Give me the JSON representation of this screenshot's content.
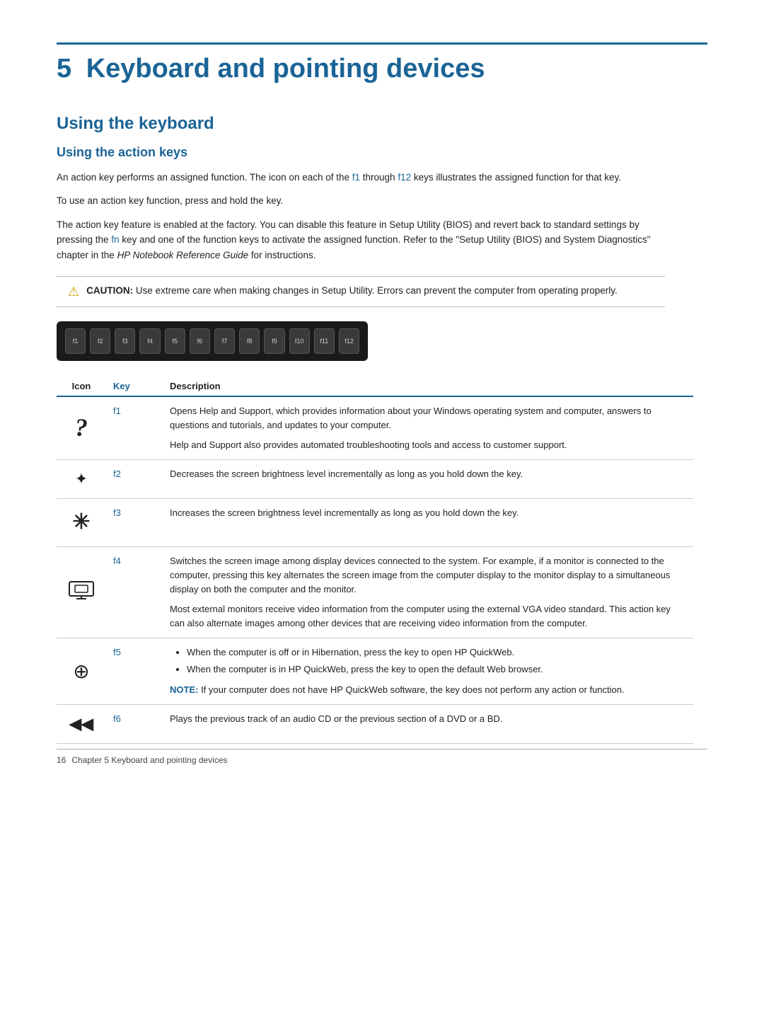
{
  "page": {
    "chapter_number": "5",
    "chapter_title": "Keyboard and pointing devices",
    "section_heading": "Using the keyboard",
    "subsection_heading": "Using the action keys",
    "paragraphs": [
      "An action key performs an assigned function. The icon on each of the f1 through f12 keys illustrates the assigned function for that key.",
      "To use an action key function, press and hold the key.",
      "The action key feature is enabled at the factory. You can disable this feature in Setup Utility (BIOS) and revert back to standard settings by pressing the fn key and one of the function keys to activate the assigned function. Refer to the “Setup Utility (BIOS) and System Diagnostics” chapter in the HP Notebook Reference Guide for instructions."
    ],
    "caution": {
      "label": "CAUTION:",
      "text": "Use extreme care when making changes in Setup Utility. Errors can prevent the computer from operating properly."
    },
    "keyboard_keys": [
      "f1",
      "f2",
      "f3",
      "f4",
      "f5",
      "f6",
      "f7",
      "f8",
      "f9",
      "f10",
      "f11",
      "f12"
    ],
    "table": {
      "headers": [
        "Icon",
        "Key",
        "Description"
      ],
      "rows": [
        {
          "icon": "?",
          "icon_type": "question",
          "key": "f1",
          "descriptions": [
            "Opens Help and Support, which provides information about your Windows operating system and computer, answers to questions and tutorials, and updates to your computer.",
            "Help and Support also provides automated troubleshooting tools and access to customer support."
          ],
          "bullets": [],
          "note": ""
        },
        {
          "icon": "☀",
          "icon_type": "sun-dim",
          "key": "f2",
          "descriptions": [
            "Decreases the screen brightness level incrementally as long as you hold down the key."
          ],
          "bullets": [],
          "note": ""
        },
        {
          "icon": "✳",
          "icon_type": "sun-bright",
          "key": "f3",
          "descriptions": [
            "Increases the screen brightness level incrementally as long as you hold down the key."
          ],
          "bullets": [],
          "note": ""
        },
        {
          "icon": "▣",
          "icon_type": "display",
          "key": "f4",
          "descriptions": [
            "Switches the screen image among display devices connected to the system. For example, if a monitor is connected to the computer, pressing this key alternates the screen image from the computer display to the monitor display to a simultaneous display on both the computer and the monitor.",
            "Most external monitors receive video information from the computer using the external VGA video standard. This action key can also alternate images among other devices that are receiving video information from the computer."
          ],
          "bullets": [],
          "note": ""
        },
        {
          "icon": "⊕",
          "icon_type": "globe",
          "key": "f5",
          "descriptions": [],
          "bullets": [
            "When the computer is off or in Hibernation, press the key to open HP QuickWeb.",
            "When the computer is in HP QuickWeb, press the key to open the default Web browser."
          ],
          "note": "NOTE:  If your computer does not have HP QuickWeb software, the key does not perform any action or function."
        },
        {
          "icon": "◀◀",
          "icon_type": "prev",
          "key": "f6",
          "descriptions": [
            "Plays the previous track of an audio CD or the previous section of a DVD or a BD."
          ],
          "bullets": [],
          "note": ""
        }
      ]
    },
    "footer": {
      "page_number": "16",
      "chapter_ref": "Chapter 5   Keyboard and pointing devices"
    }
  }
}
